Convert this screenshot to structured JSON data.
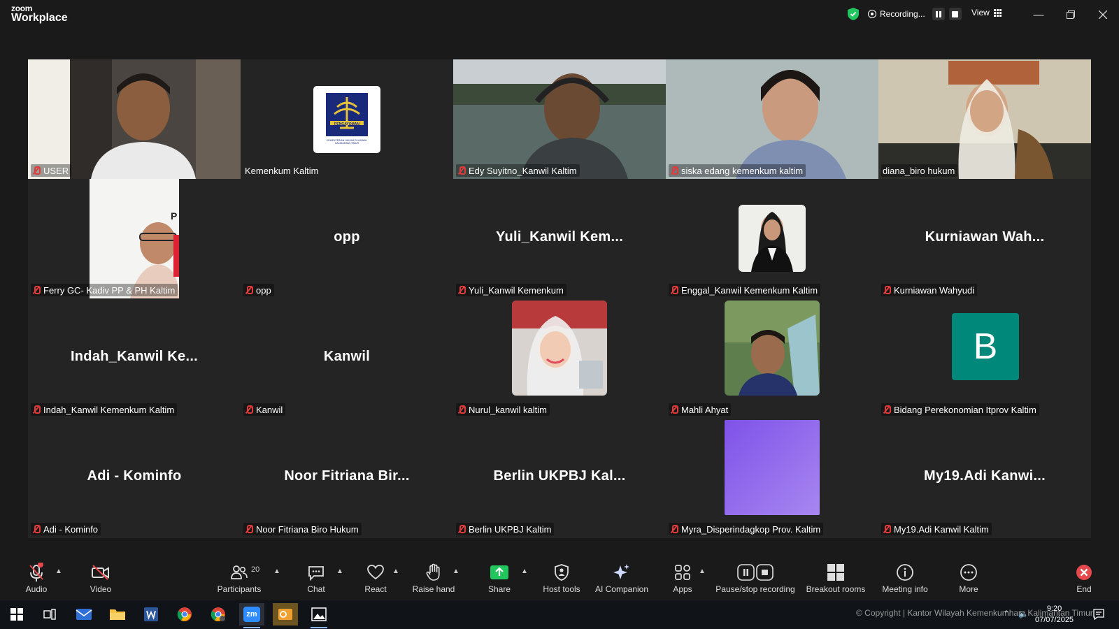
{
  "app": {
    "logo_line1": "zoom",
    "logo_line2": "Workplace"
  },
  "recording": {
    "label": "Recording...",
    "view_label": "View"
  },
  "participants_grid": [
    {
      "name": "USER",
      "display": "video",
      "active": false
    },
    {
      "name": "Kemenkum Kaltim",
      "display": "logo",
      "logo_text": "PENGAYOMAN",
      "logo_subtext": "KEMENTERIAN HUKUM RI KANWIL KALIMANTAN TIMUR",
      "active": false
    },
    {
      "name": "Edy Suyitno_Kanwil Kaltim",
      "display": "video",
      "active": false
    },
    {
      "name": "siska edang kemenkum kaltim",
      "display": "video",
      "active": false
    },
    {
      "name": "diana_biro hukum",
      "display": "video",
      "active": true
    },
    {
      "name": "Ferry GC- Kadiv PP & PH Kaltim",
      "display": "photo",
      "active": false
    },
    {
      "name": "opp",
      "big_name": "opp",
      "display": "name",
      "active": false
    },
    {
      "name": "Yuli_Kanwil Kemenkum",
      "big_name": "Yuli_Kanwil  Kem...",
      "display": "name",
      "active": false
    },
    {
      "name": "Enggal_Kanwil Kemenkum Kaltim",
      "display": "photo",
      "active": false
    },
    {
      "name": "Kurniawan Wahyudi",
      "big_name": "Kurniawan  Wah...",
      "display": "name",
      "active": false
    },
    {
      "name": "Indah_Kanwil Kemenkum Kaltim",
      "big_name": "Indah_Kanwil  Ke...",
      "display": "name",
      "active": false
    },
    {
      "name": "Kanwil",
      "big_name": "Kanwil",
      "display": "name",
      "active": false
    },
    {
      "name": "Nurul_kanwil kaltim",
      "display": "photo",
      "active": false
    },
    {
      "name": "Mahli Ahyat",
      "display": "photo",
      "active": false
    },
    {
      "name": "Bidang Perekonomian Itprov Kaltim",
      "display": "initial",
      "initial": "B",
      "active": false
    },
    {
      "name": "Adi - Kominfo",
      "big_name": "Adi - Kominfo",
      "display": "name",
      "active": false
    },
    {
      "name": "Noor Fitriana Biro Hukum",
      "big_name": "Noor  Fitriana  Bir...",
      "display": "name",
      "active": false
    },
    {
      "name": "Berlin UKPBJ Kaltim",
      "big_name": "Berlin  UKPBJ  Kal...",
      "display": "name",
      "active": false
    },
    {
      "name": "Myra_Disperindagkop Prov. Kaltim",
      "display": "photo",
      "active": false
    },
    {
      "name": "My19.Adi Kanwil Kaltim",
      "big_name": "My19.Adi  Kanwi...",
      "display": "name",
      "active": false
    }
  ],
  "toolbar": {
    "audio": "Audio",
    "video": "Video",
    "participants": "Participants",
    "participants_count": "20",
    "chat": "Chat",
    "react": "React",
    "raise_hand": "Raise hand",
    "share": "Share",
    "host_tools": "Host tools",
    "ai_companion": "AI Companion",
    "apps": "Apps",
    "pause_stop_recording": "Pause/stop recording",
    "breakout_rooms": "Breakout rooms",
    "meeting_info": "Meeting info",
    "more": "More",
    "end": "End"
  },
  "taskbar": {
    "copyright": "© Copyright | Kantor Wilayah Kemenkumham Kalimantan Timur",
    "time": "9:20",
    "date": "07/07/2025",
    "zoom_label": "zm"
  },
  "colors": {
    "accent_green": "#4bd98a",
    "mute_red": "#e03b3b",
    "share_green": "#23c55e",
    "end_red": "#e5484d",
    "avatar_teal": "#00897b"
  }
}
